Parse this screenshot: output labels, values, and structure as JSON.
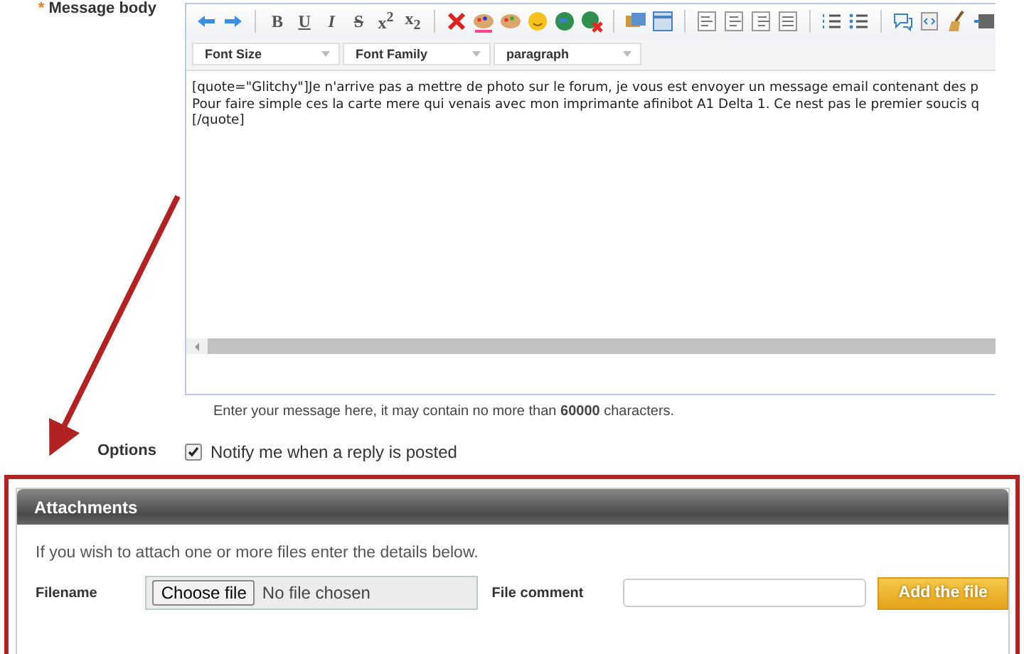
{
  "message_field": {
    "required_mark": "*",
    "label": "Message body"
  },
  "editor": {
    "format_buttons": [
      "B",
      "U",
      "I",
      "S",
      "x$^{2}$",
      "x$_{2}$"
    ],
    "selects": [
      {
        "label": "Font Size"
      },
      {
        "label": "Font Family"
      },
      {
        "label": "paragraph"
      }
    ],
    "lines": [
      "[quote=\"Glitchy\"]Je n'arrive pas a mettre de photo sur le forum, je vous est envoyer un message email contenant des p",
      "Pour faire simple ces la carte mere qui venais avec mon imprimante afinibot A1 Delta 1. Ce nest pas le premier soucis q",
      "[/quote]"
    ]
  },
  "hint": "Enter your message here, it may contain no more than **60000** characters.",
  "options": {
    "label": "Options",
    "checkbox": {
      "label": "Notify me when a reply is posted",
      "checked": true
    }
  },
  "attachments": {
    "title": "Attachments",
    "intro": "If you wish to attach one or more files enter the details below.",
    "filename_label": "Filename",
    "choose_button": "Choose file",
    "no_file": "No file chosen",
    "comment_label": "File comment",
    "add_button": "Add the file"
  }
}
